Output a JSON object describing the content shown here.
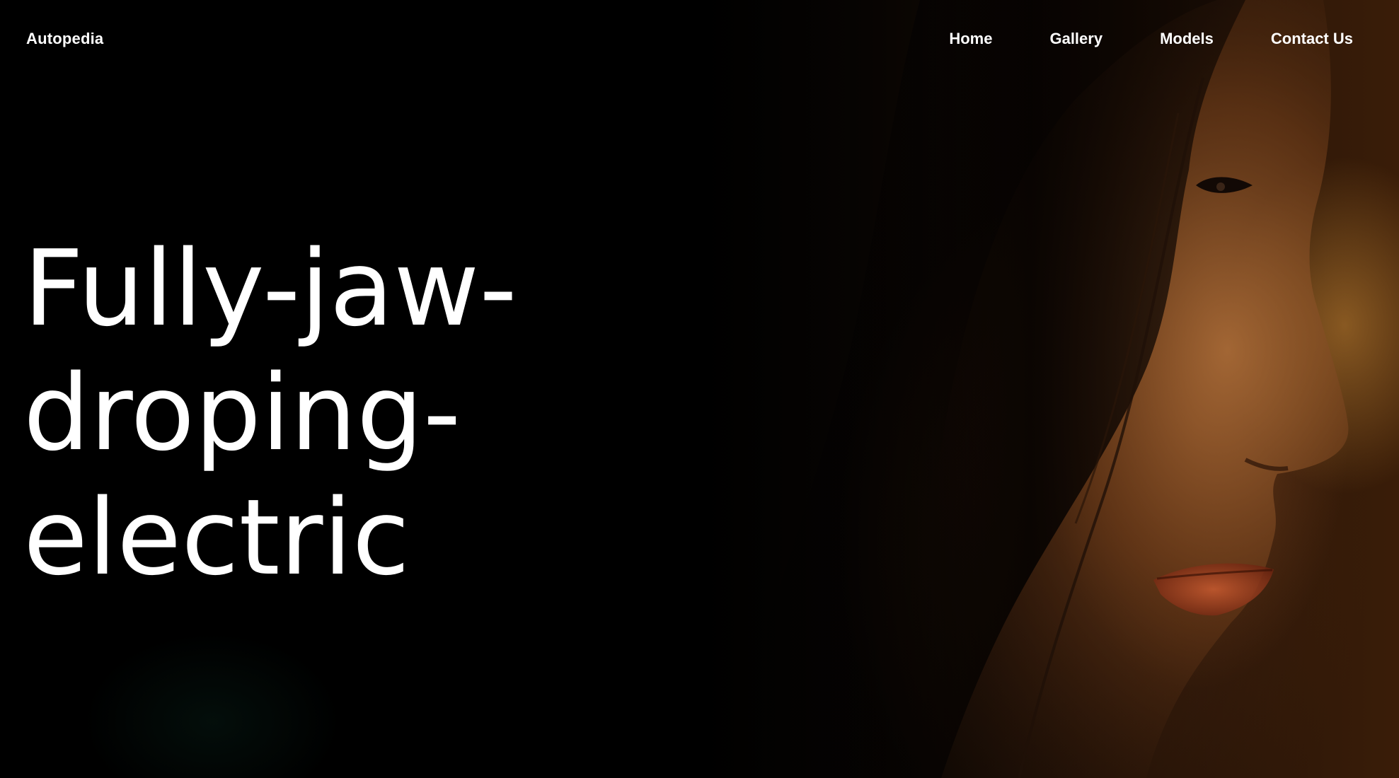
{
  "header": {
    "brand": "Autopedia",
    "nav": [
      {
        "label": "Home"
      },
      {
        "label": "Gallery"
      },
      {
        "label": "Models"
      },
      {
        "label": "Contact Us"
      }
    ]
  },
  "hero": {
    "headline_lines": [
      "Fully-jaw-",
      "droping-",
      "electric"
    ],
    "background_media": "portrait of a woman in warm low light"
  },
  "colors": {
    "background": "#000000",
    "text": "#ffffff",
    "warm_light": "#cd8c37"
  }
}
